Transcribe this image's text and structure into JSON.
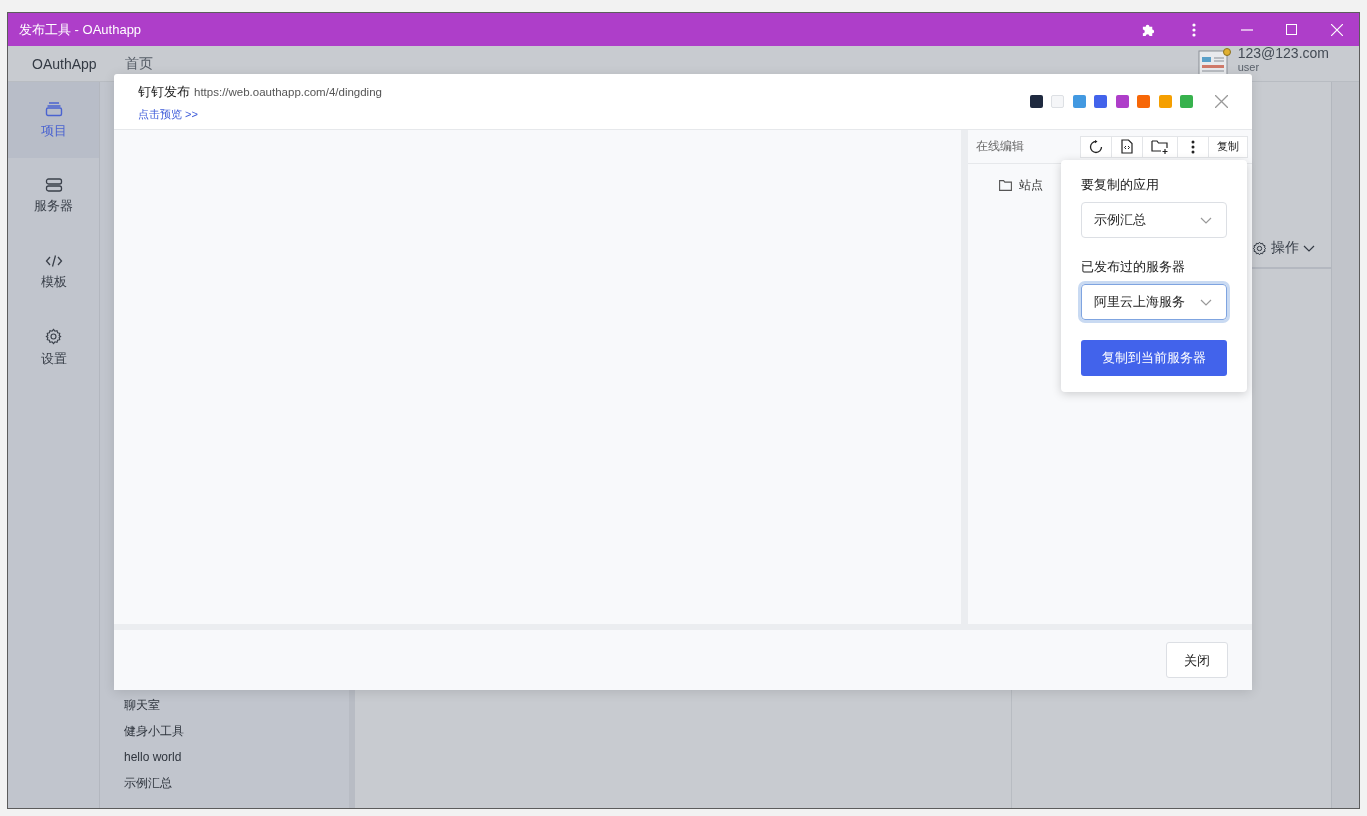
{
  "window": {
    "title": "发布工具 - OAuthapp"
  },
  "top_bar": {
    "brand": "OAuthApp",
    "nav": [
      {
        "label": "首页"
      }
    ],
    "user": {
      "email": "123@123.com",
      "role": "user"
    }
  },
  "rail": [
    {
      "kind": "project",
      "label": "项目",
      "selected": true
    },
    {
      "kind": "server",
      "label": "服务器",
      "selected": false
    },
    {
      "kind": "template",
      "label": "模板",
      "selected": false
    },
    {
      "kind": "settings",
      "label": "设置",
      "selected": false
    }
  ],
  "project_list": [
    "聊天室",
    "健身小工具",
    "hello world",
    "示例汇总"
  ],
  "detail_panel": {
    "action": "操作"
  },
  "modal": {
    "title": "钉钉发布",
    "url": "https://web.oauthapp.com/4/dingding",
    "preview_link": "点击预览 >>",
    "swatches": [
      {
        "color": "#1f2a40"
      },
      {
        "color": "#f5f6f8"
      },
      {
        "color": "#4299e1"
      },
      {
        "color": "#4263eb"
      },
      {
        "color": "#ae3ec9"
      },
      {
        "color": "#f76707"
      },
      {
        "color": "#f59f00"
      },
      {
        "color": "#37b24d"
      }
    ],
    "editor": {
      "title": "在线编辑",
      "toolbar": [
        {
          "kind": "refresh"
        },
        {
          "kind": "file-code"
        },
        {
          "kind": "folder-add"
        },
        {
          "kind": "more"
        },
        {
          "kind": "text",
          "label": "复制"
        }
      ],
      "tree": [
        {
          "label": "站点"
        }
      ]
    },
    "copy_popover": {
      "app_label": "要复制的应用",
      "app_select": {
        "value": "示例汇总",
        "focused": false
      },
      "server_label": "已发布过的服务器",
      "server_select": {
        "value": "阿里云上海服务",
        "focused": true
      },
      "submit": "复制到当前服务器"
    },
    "close_button": "关闭"
  }
}
